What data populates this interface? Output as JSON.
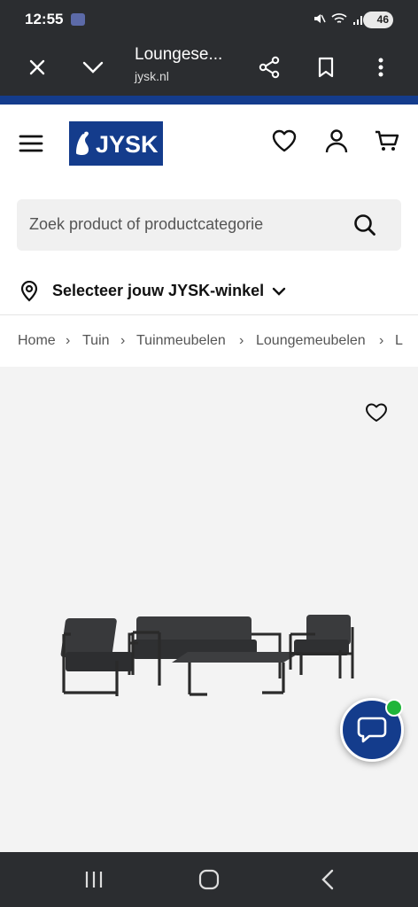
{
  "status_bar": {
    "time": "12:55",
    "battery": "46",
    "icons": [
      "mute-icon",
      "wifi-icon",
      "signal-icon",
      "battery-icon"
    ]
  },
  "browser": {
    "page_title": "Loungese...",
    "url": "jysk.nl",
    "icons": [
      "close-icon",
      "chevron-down-icon",
      "share-icon",
      "bookmark-icon",
      "more-icon"
    ]
  },
  "header": {
    "logo_text": "JYSK",
    "brand_color": "#143c8c",
    "icons": [
      "menu-icon",
      "heart-icon",
      "user-icon",
      "cart-icon"
    ]
  },
  "search": {
    "placeholder": "Zoek product of productcategorie"
  },
  "store_selector": {
    "label": "Selecteer jouw JYSK-winkel"
  },
  "breadcrumb": {
    "items": [
      "Home",
      "Tuin",
      "Tuinmeubelen",
      "Loungemeubelen",
      "L"
    ],
    "separator": "›"
  },
  "product_gallery": {
    "image": "grey-aluminium-lounge-set",
    "icons": [
      "heart-outline-icon"
    ]
  },
  "chat": {
    "status_color": "#1fb53a"
  },
  "nav_bar": {
    "icons": [
      "recents-icon",
      "home-icon",
      "back-icon"
    ]
  }
}
